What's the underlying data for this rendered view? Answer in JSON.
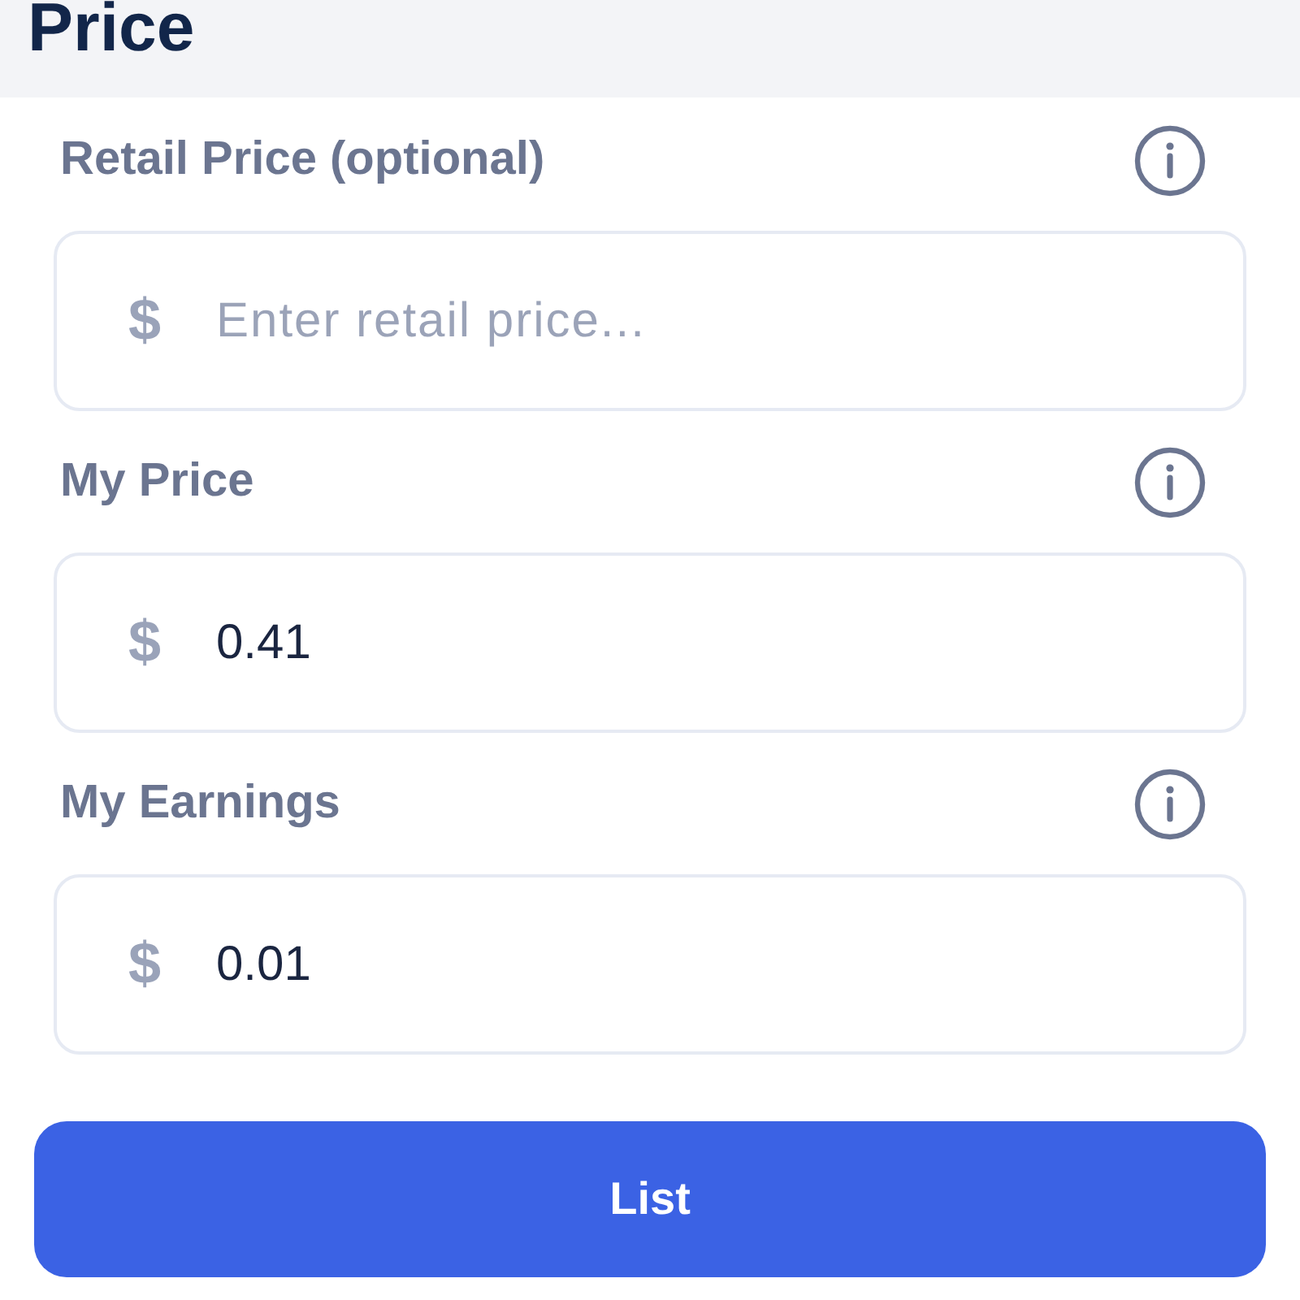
{
  "header": {
    "title": "Price"
  },
  "fields": [
    {
      "label": "Retail Price (optional)",
      "currency": "$",
      "placeholder": "Enter retail price..."
    },
    {
      "label": "My Price",
      "currency": "$",
      "value": "0.41"
    },
    {
      "label": "My Earnings",
      "currency": "$",
      "value": "0.01"
    }
  ],
  "button": {
    "label": "List"
  }
}
